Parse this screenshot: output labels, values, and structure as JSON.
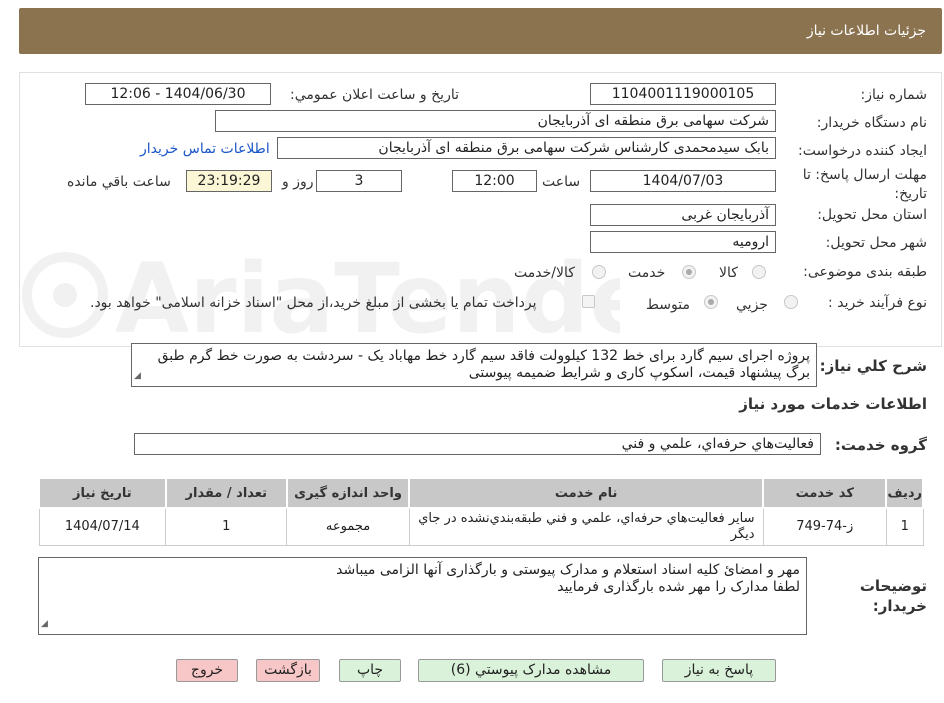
{
  "header": {
    "title": "جزئیات اطلاعات نیاز"
  },
  "form": {
    "need_number_label": "شماره نیاز:",
    "need_number": "1104001119000105",
    "announce_label": "تاريخ و ساعت اعلان عمومي:",
    "announce_value": "1404/06/30 - 12:06",
    "buyer_org_label": "نام دستگاه خريدار:",
    "buyer_org": "شرکت سهامی برق منطقه ای آذربایجان",
    "requester_label": "ايجاد کننده درخواست:",
    "requester": "بابک سیدمحمدی کارشناس شرکت سهامی برق منطقه ای آذربایجان",
    "contact_link": "اطلاعات تماس خريدار",
    "deadline_label": "مهلت ارسال پاسخ: تا تاريخ:",
    "deadline_date": "1404/07/03",
    "time_label": "ساعت",
    "deadline_time": "12:00",
    "days": "3",
    "days_label": "روز و",
    "remaining": "23:19:29",
    "remaining_label": "ساعت باقي مانده",
    "province_label": "استان محل تحويل:",
    "province": "آذربایجان غربی",
    "city_label": "شهر محل تحويل:",
    "city": "ارومیه",
    "category_label": "طبقه بندی موضوعی:",
    "category_options": [
      "کالا",
      "خدمت",
      "کالا/خدمت"
    ],
    "category_selected": "خدمت",
    "process_label": "نوع فرآيند خريد :",
    "process_options": [
      "جزيي",
      "متوسط"
    ],
    "process_selected": "متوسط",
    "payment_note": "پرداخت تمام يا بخشی از مبلغ خريد،از محل \"اسناد خزانه اسلامی\" خواهد بود."
  },
  "description": {
    "label": "شرح کلي نياز:",
    "text": "پروژه اجرای سیم گارد برای خط 132 کیلوولت فاقد سیم گارد خط مهاباد یک - سردشت به صورت خط گرم طبق برگ پیشنهاد قیمت، اسکوپ کاری و شرایط ضمیمه پیوستی"
  },
  "services": {
    "section_title": "اطلاعات خدمات مورد نياز",
    "group_label": "گروه خدمت:",
    "group_value": "فعاليت‌هاي حرفه‌اي، علمي و فني",
    "columns": [
      "رديف",
      "کد خدمت",
      "نام خدمت",
      "واحد اندازه گيری",
      "تعداد / مقدار",
      "تاريخ نياز"
    ],
    "rows": [
      {
        "index": "1",
        "code": "ز-74-749",
        "name": "ساير فعاليت‌هاي حرفه‌اي، علمي و فني طبقه‌بندي‌نشده در جاي ديگر",
        "unit": "مجموعه",
        "quantity": "1",
        "date": "1404/07/14"
      }
    ]
  },
  "buyer_notes": {
    "label": "توضيحات خريدار:",
    "line1": "مهر و امضائ کلیه اسناد استعلام و مدارک پیوستی و بارگذاری آنها الزامی میباشد",
    "line2": "لطفا مدارک را مهر شده بارگذاری فرمایید"
  },
  "buttons": {
    "reply": "پاسخ به نياز",
    "attachments": "مشاهده مدارک پيوستي (6)",
    "print": "چاپ",
    "back": "بازگشت",
    "exit": "خروج"
  },
  "colors": {
    "header_bg": "#8b7350",
    "link": "#1a56c8",
    "green_btn": "#d9f2d9",
    "pink_btn": "#f7c6c6"
  }
}
